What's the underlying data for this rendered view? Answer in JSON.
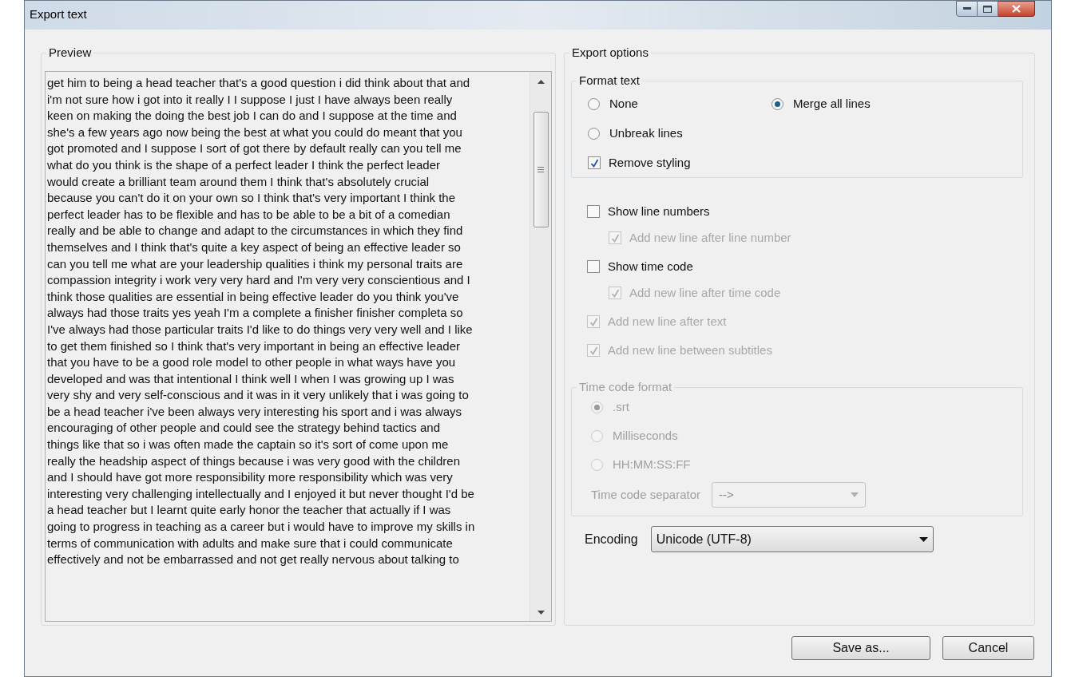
{
  "window": {
    "title": "Export text"
  },
  "preview": {
    "label": "Preview",
    "lines": [
      "get him to being a head teacher that's a good question i did think about that and",
      "i'm not sure how i got into it really I I suppose I just I have always been really",
      "keen on making the doing the best job I can do and I suppose at the time and",
      "she's a few years ago now being the best at what you could do meant that you",
      "got promoted and I suppose I sort of got there by default really can you tell me",
      "what do you think is the shape of a perfect leader I think the perfect leader",
      "would create a brilliant team around them I think that's absolutely crucial",
      "because you can't do it on your own so I think that's very important I think the",
      "perfect leader has to be flexible and has to be able to be a bit of a comedian",
      "really and be able to change and adapt to the circumstances in which they find",
      "themselves and I think that's quite a key aspect of being an effective leader so",
      "can you tell me what are your leadership qualities i think my personal traits are",
      "compassion integrity i work very very hard and I'm very very conscientious and I",
      "think those qualities are essential in being effective leader do you think you've",
      "always had those traits yes yeah I'm a complete a finisher finisher completa so",
      "I've always had those particular traits I'd like to do things very very well and I like",
      "to get them finished so I think that's very important in being an effective leader",
      "that you have to be a good role model to other people in what ways have you",
      "developed and was that intentional I think well I when I was growing up I was",
      "very shy and very self-conscious and it was in it very unlikely that i was going to",
      "be a head teacher i've been always very interesting his sport and i was always",
      "encouraging of other people and could see the strategy behind tactics and",
      "things like that so i was often made the captain so it's sort of come upon me",
      "really the headship aspect of things because i was very good with the children",
      "and I should have got more responsibility more responsibility which was very",
      "interesting very challenging intellectually and I enjoyed it but never thought I'd be",
      "a head teacher but I learnt quite early honor the teacher that actually if I was",
      "going to progress in teaching as a career but i would have to improve my skills in",
      "terms of communication with adults and make sure that i could communicate",
      "effectively and not be embarrassed and not get really nervous about talking to"
    ]
  },
  "export_options": {
    "label": "Export options",
    "format_text": {
      "label": "Format text",
      "options": [
        {
          "label": "None",
          "selected": false
        },
        {
          "label": "Merge all lines",
          "selected": true
        },
        {
          "label": "Unbreak lines",
          "selected": false
        }
      ],
      "remove_styling": {
        "label": "Remove styling",
        "checked": true,
        "disabled": false
      }
    },
    "checkboxes": [
      {
        "label": "Show line numbers",
        "checked": false,
        "disabled": false,
        "children": [
          {
            "label": "Add new line after line number",
            "checked": true,
            "disabled": true
          }
        ]
      },
      {
        "label": "Show time code",
        "checked": false,
        "disabled": false,
        "children": [
          {
            "label": "Add new line after time code",
            "checked": true,
            "disabled": true
          }
        ]
      },
      {
        "label": "Add new line after text",
        "checked": true,
        "disabled": true
      },
      {
        "label": "Add new line between subtitles",
        "checked": true,
        "disabled": true
      }
    ],
    "time_code_format": {
      "label": "Time code format",
      "disabled": true,
      "options": [
        {
          "label": ".srt",
          "selected": true
        },
        {
          "label": "Milliseconds",
          "selected": false
        },
        {
          "label": "HH:MM:SS:FF",
          "selected": false
        }
      ],
      "separator": {
        "label": "Time code separator",
        "value": "-->"
      }
    },
    "encoding": {
      "label": "Encoding",
      "value": "Unicode (UTF-8)"
    }
  },
  "buttons": [
    "Save as...",
    "Cancel"
  ]
}
